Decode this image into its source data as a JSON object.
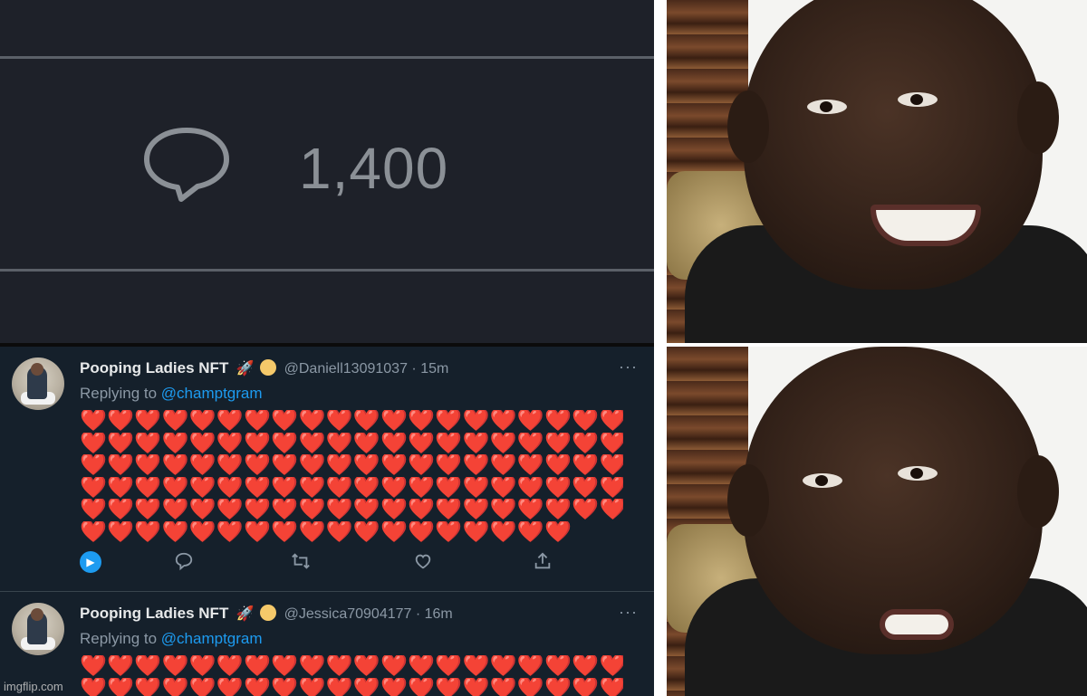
{
  "zoom": {
    "reply_count": "1,400",
    "icon": "comment-bubble-icon"
  },
  "tweets": [
    {
      "display_name": "Pooping Ladies NFT",
      "emoji": "🚀",
      "handle_time": "@Daniell13091037 · 15m",
      "more": "···",
      "reply_prefix": "Replying to ",
      "reply_mention": "@champtgram",
      "heart_rows": [
        "❤️❤️❤️❤️❤️❤️❤️❤️❤️❤️❤️❤️❤️❤️❤️❤️❤️❤️❤️❤️❤️❤️❤️❤️",
        "❤️❤️❤️❤️❤️❤️❤️❤️❤️❤️❤️❤️❤️❤️❤️❤️❤️❤️❤️❤️❤️❤️❤️❤️",
        "❤️❤️❤️❤️❤️❤️❤️❤️❤️❤️❤️❤️❤️❤️❤️❤️❤️❤️❤️❤️❤️❤️❤️❤️",
        "❤️❤️❤️❤️❤️❤️❤️❤️❤️❤️❤️❤️❤️❤️❤️❤️❤️❤️❤️❤️❤️❤️❤️❤️",
        "❤️❤️❤️❤️❤️❤️❤️❤️❤️❤️❤️❤️❤️❤️❤️❤️❤️❤️❤️❤️❤️❤️❤️❤️",
        "❤️❤️❤️❤️❤️❤️❤️❤️❤️❤️❤️❤️❤️❤️❤️❤️❤️❤️"
      ]
    },
    {
      "display_name": "Pooping Ladies NFT",
      "emoji": "🚀",
      "handle_time": "@Jessica70904177 · 16m",
      "more": "···",
      "reply_prefix": "Replying to ",
      "reply_mention": "@champtgram",
      "heart_rows": [
        "❤️❤️❤️❤️❤️❤️❤️❤️❤️❤️❤️❤️❤️❤️❤️❤️❤️❤️❤️❤️❤️❤️❤️❤️",
        "❤️❤️❤️❤️❤️❤️❤️❤️❤️❤️❤️❤️❤️❤️❤️❤️❤️❤️❤️❤️❤️❤️❤️❤️"
      ]
    }
  ],
  "actions": {
    "play_icon": "play-icon",
    "reply_icon": "reply-icon",
    "retweet_icon": "retweet-icon",
    "like_icon": "like-icon",
    "share_icon": "share-icon"
  },
  "watermark": "imgflip.com",
  "colors": {
    "link": "#1d9bf0",
    "heart": "#f4212e",
    "background": "#15202b"
  }
}
